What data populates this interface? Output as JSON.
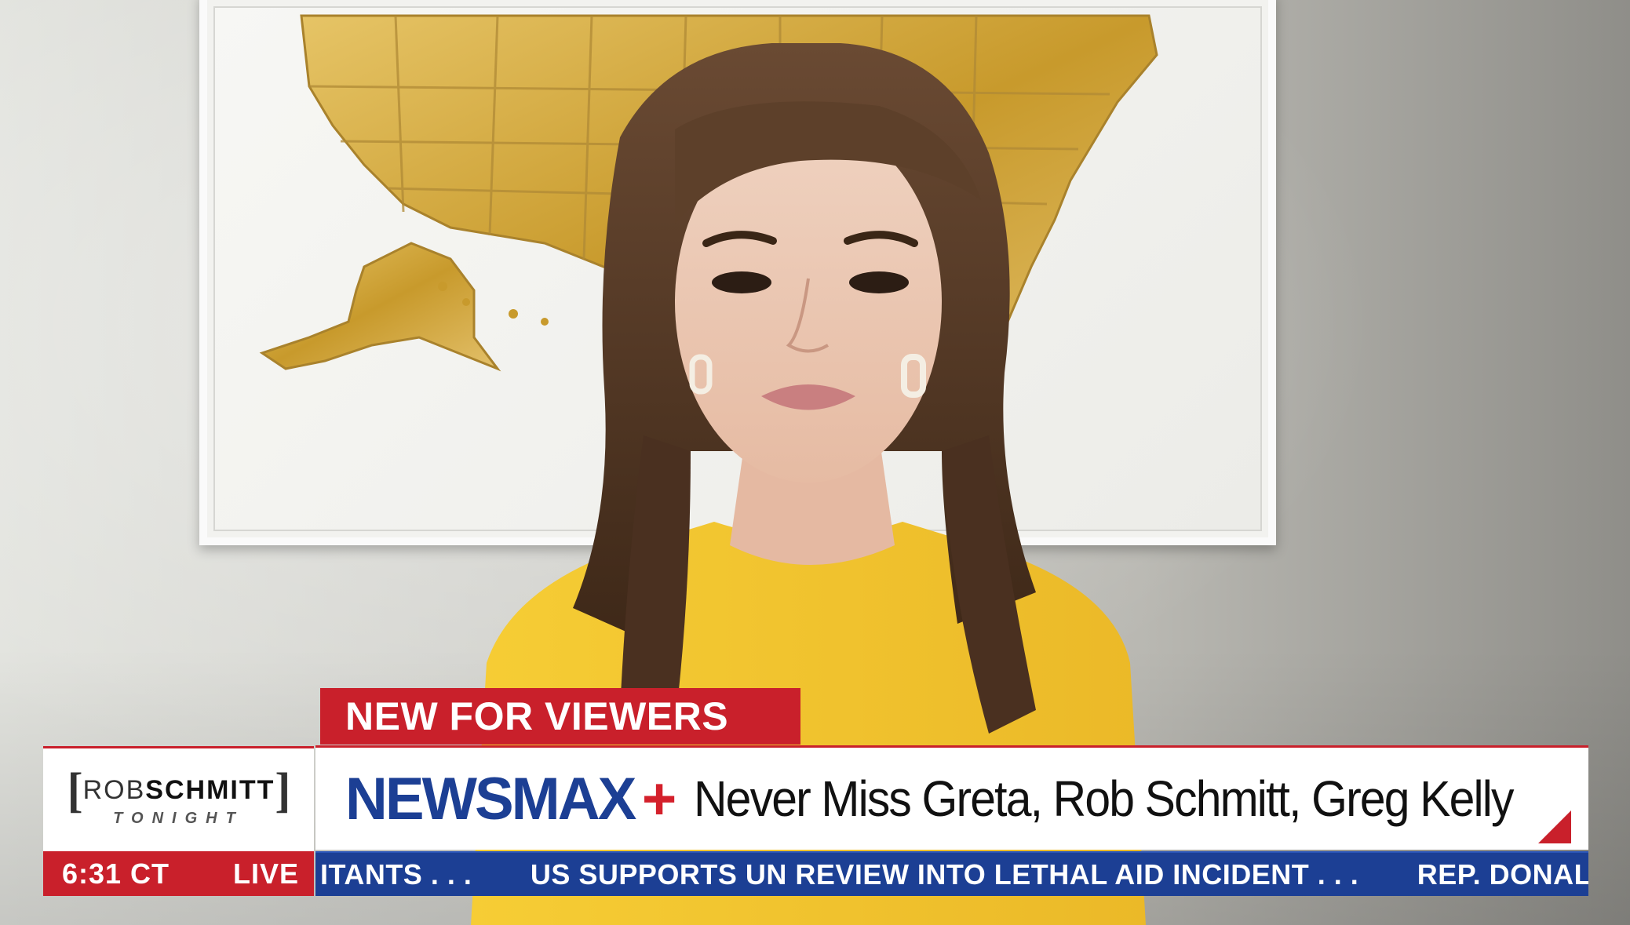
{
  "lower_third": {
    "tag": "NEW FOR VIEWERS",
    "brand": "NEWSMAX",
    "brand_plus": "+",
    "headline": "Never Miss Greta, Rob Schmitt, Greg Kelly"
  },
  "show_bug": {
    "name_part1": "ROB",
    "name_part2": "SCHMITT",
    "subtitle": "TONIGHT",
    "bracket_left": "[",
    "bracket_right": "]"
  },
  "status": {
    "time": "6:31 CT",
    "live": "LIVE"
  },
  "ticker": {
    "items": [
      "ITANTS . . .",
      "US SUPPORTS UN REVIEW INTO LETHAL AID INCIDENT . . .",
      "REP. DONAL"
    ]
  },
  "colors": {
    "red": "#c9202b",
    "navy": "#1c3f94",
    "shirt": "#f2c62a",
    "map_gold": "#d8b24a"
  }
}
